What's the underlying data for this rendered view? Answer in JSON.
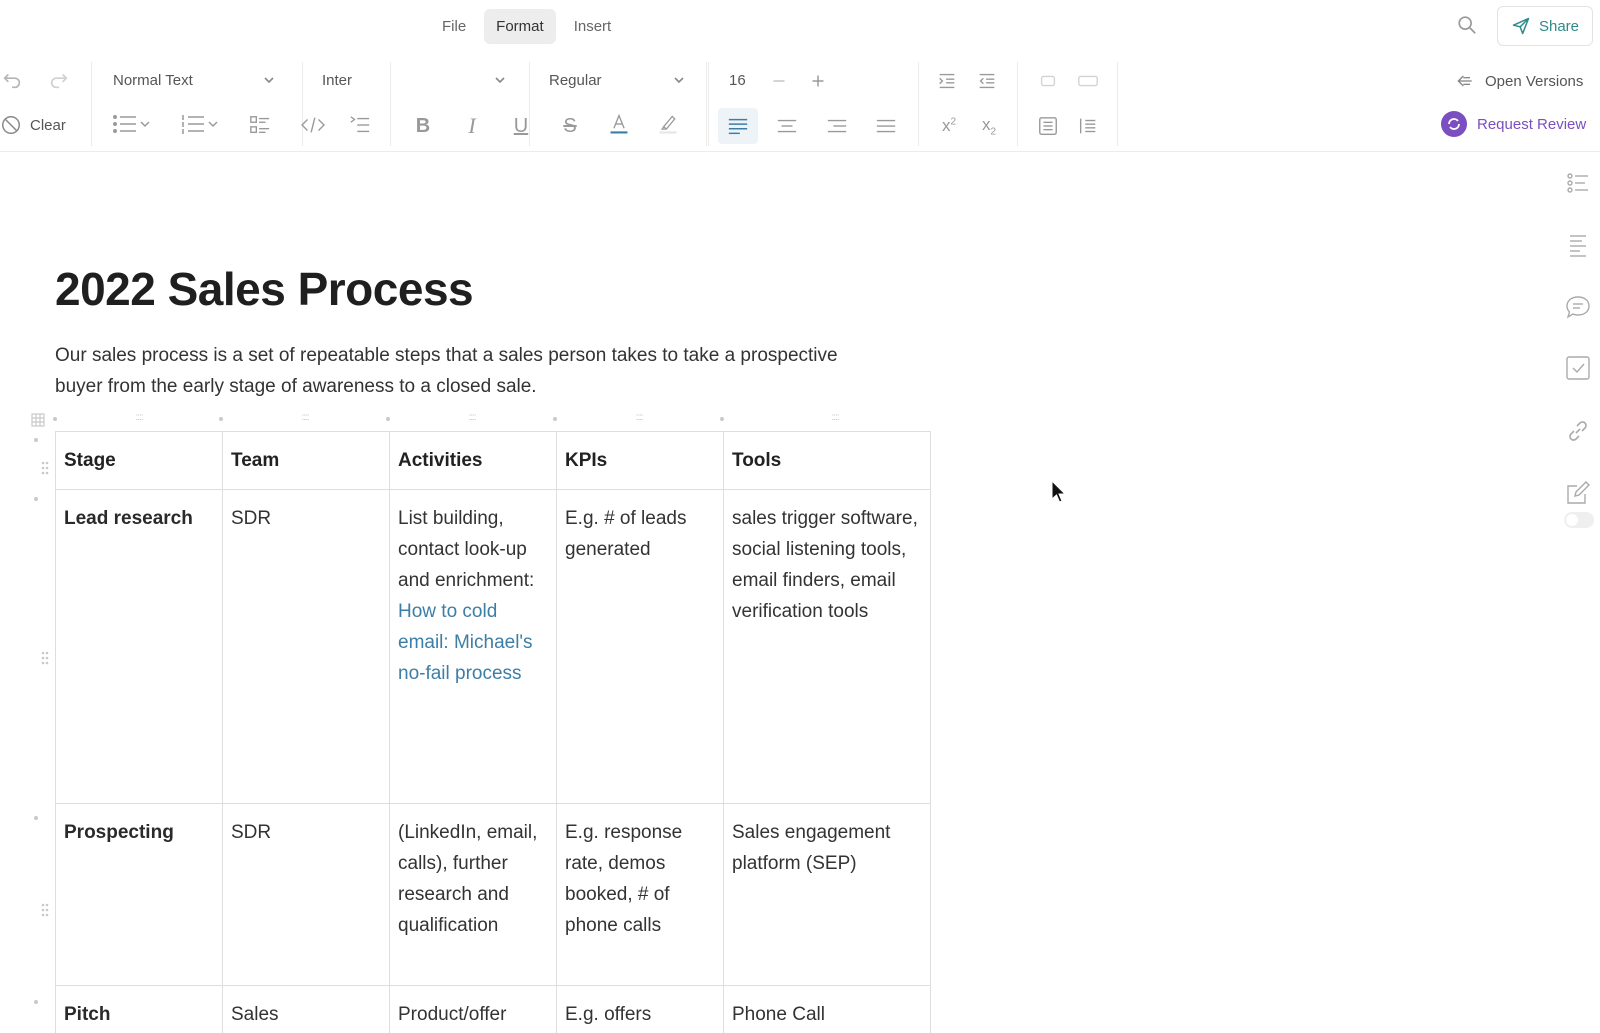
{
  "menu": {
    "tabs": [
      "File",
      "Format",
      "Insert"
    ],
    "active": "Format"
  },
  "share_label": "Share",
  "toolbar": {
    "text_style": "Normal Text",
    "font_family": "Inter",
    "font_weight": "Regular",
    "font_size": "16",
    "clear_label": "Clear",
    "open_versions_label": "Open Versions",
    "request_review_label": "Request Review",
    "icons": [
      "undo-icon",
      "redo-icon",
      "bullet-list-icon",
      "numbered-list-icon",
      "checklist-icon",
      "code-icon",
      "outline-icon",
      "bold-icon",
      "italic-icon",
      "underline-icon",
      "strikethrough-icon",
      "text-color-icon",
      "highlight-icon",
      "align-left-icon",
      "align-center-icon",
      "align-right-icon",
      "justify-icon",
      "superscript-icon",
      "subscript-icon",
      "indent-icon",
      "outdent-icon"
    ],
    "accent_color": "#7b4fc0",
    "share_color": "#2f8a8a"
  },
  "doc": {
    "title": "2022 Sales Process",
    "intro": "Our sales process is a set of repeatable steps that a sales person takes to take a prospective buyer from the early stage of awareness to a closed sale."
  },
  "table": {
    "headers": [
      "Stage",
      "Team",
      "Activities",
      "KPIs",
      "Tools"
    ],
    "rows": [
      {
        "stage": "Lead research",
        "team": "SDR",
        "activities": "List building, contact look-up and enrichment:",
        "activities_link": "How to cold email: Michael's no-fail process",
        "kpis": "E.g. # of leads generated",
        "tools": "sales trigger software, social listening tools, email finders, email verification tools"
      },
      {
        "stage": "Prospecting",
        "team": "SDR",
        "activities": "(LinkedIn, email, calls), further research and qualification",
        "kpis": "E.g. response rate, demos booked, # of phone calls",
        "tools": "Sales engagement platform (SEP)"
      },
      {
        "stage": "Pitch",
        "team": "Sales",
        "activities": "Product/offer",
        "kpis": "E.g. offers",
        "tools": "Phone Call"
      }
    ]
  },
  "right_rail_icons": [
    "toc-icon",
    "align-icon",
    "comment-icon",
    "task-icon",
    "link-icon",
    "edit-icon"
  ]
}
